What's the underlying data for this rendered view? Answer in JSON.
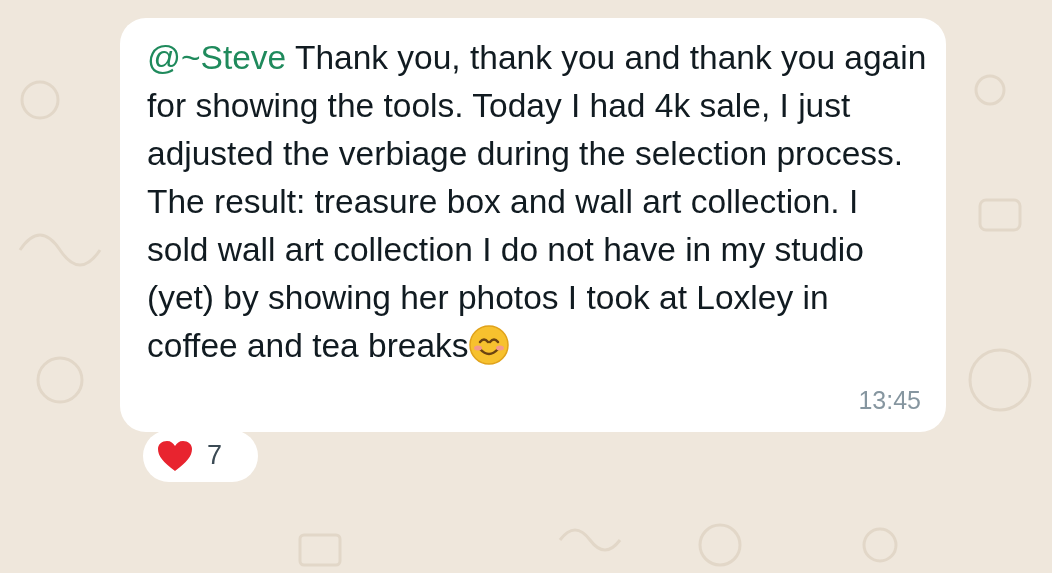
{
  "message": {
    "mention": "@~Steve",
    "text": "Thank you, thank you and thank you again for showing the tools. Today I had 4k sale, I just adjusted the verbiage during the selection process. The result: treasure box and wall art collection. I sold wall art collection I do not have in my studio (yet) by showing her photos I took at Loxley in coffee and tea breaks",
    "time": "13:45"
  },
  "reaction": {
    "count": "7"
  }
}
